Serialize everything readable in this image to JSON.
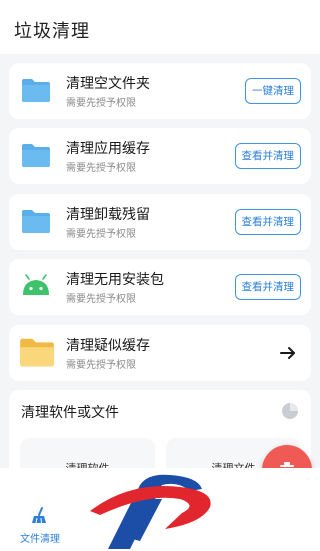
{
  "header": {
    "title": "垃圾清理"
  },
  "cards": [
    {
      "title": "清理空文件夹",
      "subtitle": "需要先授予权限",
      "icon": "folder-icon",
      "button": "一键清理"
    },
    {
      "title": "清理应用缓存",
      "subtitle": "需要先授予权限",
      "icon": "folder-icon",
      "button": "查看并清理"
    },
    {
      "title": "清理卸载残留",
      "subtitle": "需要先授予权限",
      "icon": "folder-icon",
      "button": "查看并清理"
    },
    {
      "title": "清理无用安装包",
      "subtitle": "需要先授予权限",
      "icon": "android-icon",
      "button": "查看并清理"
    },
    {
      "title": "清理疑似缓存",
      "subtitle": "需要先授予权限",
      "icon": "yellow-folder-icon",
      "arrow": "arrow-right-icon"
    }
  ],
  "section": {
    "title": "清理软件或文件",
    "icon": "pie-chart-icon",
    "tiles": [
      "清理软件",
      "清理文件"
    ]
  },
  "fab": {
    "icon": "trash-icon",
    "color": "#f05a55"
  },
  "bottom_nav": {
    "active_tab": "文件清理",
    "icon": "broom-icon"
  },
  "overlay": {
    "icon": "logo-icon"
  },
  "colors": {
    "accent": "#2c7fd8",
    "folder_blue": "#5aaeea",
    "folder_yellow": "#f6c95c",
    "android_green": "#3fc26c"
  }
}
